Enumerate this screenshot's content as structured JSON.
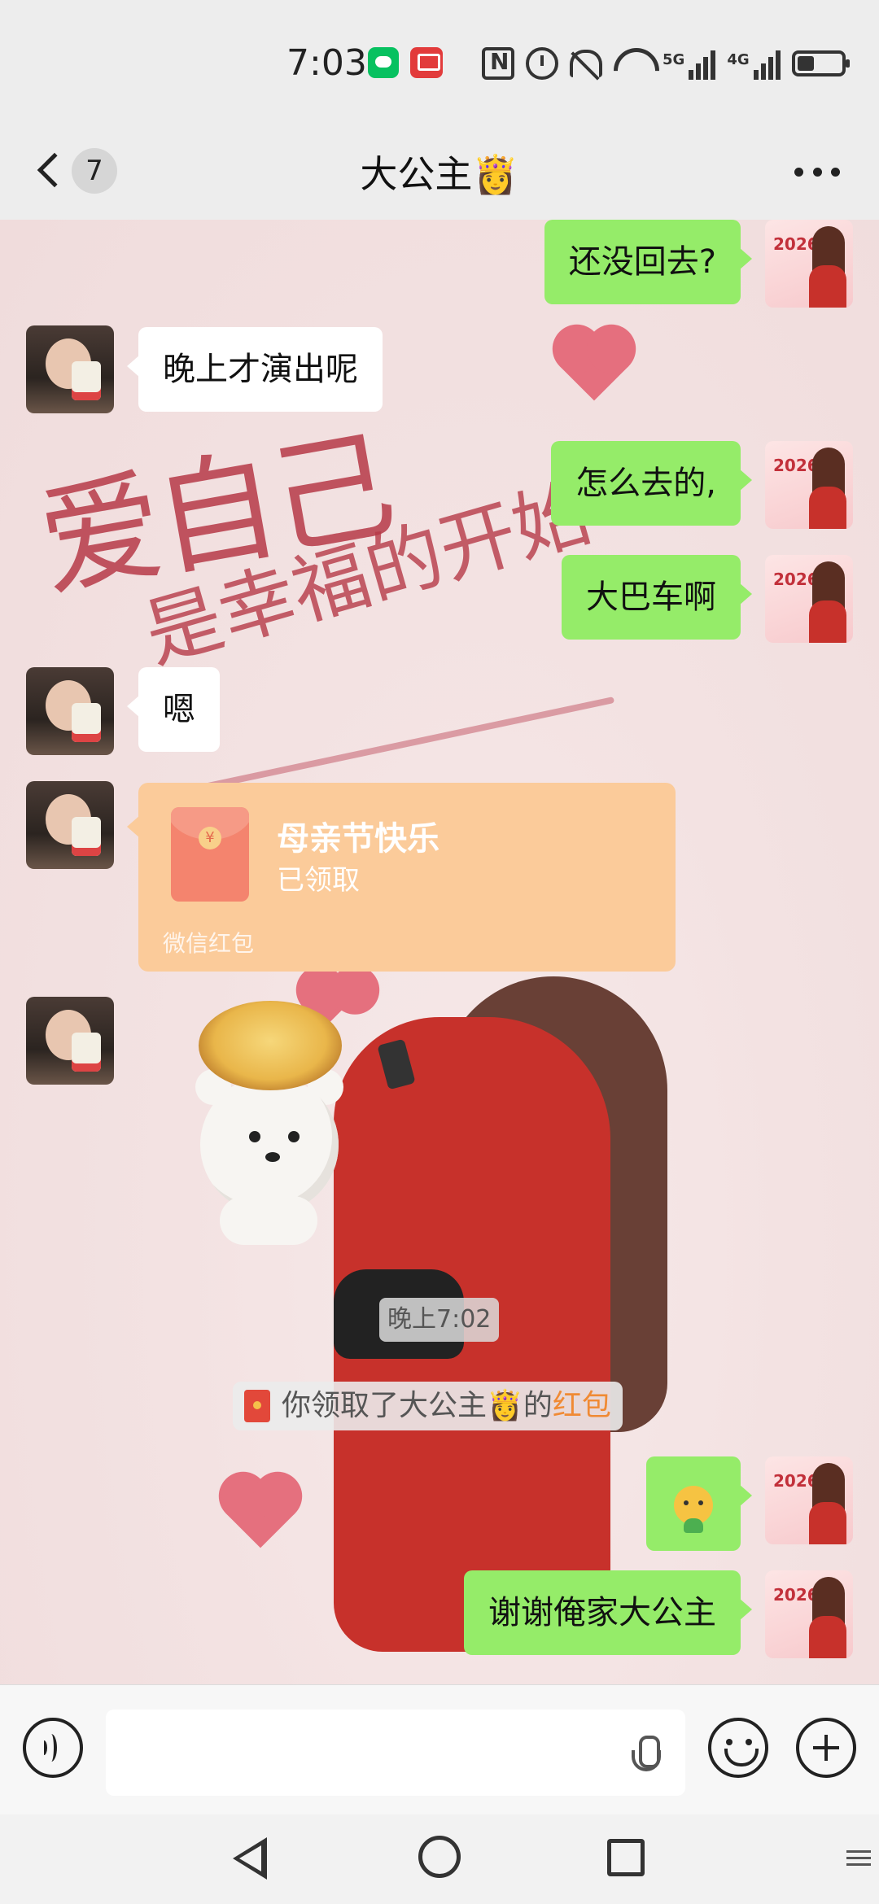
{
  "status_bar": {
    "time": "7:03",
    "network_1": "5G",
    "network_2": "4G",
    "icons": [
      "wechat-notification-icon",
      "app-notification-icon",
      "nfc-icon",
      "alarm-icon",
      "mute-icon",
      "wifi-icon",
      "signal-icon",
      "battery-icon"
    ],
    "battery_level": 0.4
  },
  "header": {
    "back_badge": "7",
    "title": "大公主👸"
  },
  "background": {
    "line1": "爱自己",
    "line2": "是幸福的开始"
  },
  "messages": [
    {
      "side": "out",
      "text": "还没回去?"
    },
    {
      "side": "in",
      "text": "晚上才演出呢"
    },
    {
      "side": "out",
      "text": "怎么去的,"
    },
    {
      "side": "out",
      "text": "大巴车啊"
    },
    {
      "side": "in",
      "text": "嗯"
    }
  ],
  "red_packet": {
    "title": "母亲节快乐",
    "status": "已领取",
    "label": "微信红包",
    "coin_symbol": "¥"
  },
  "time_stamp": "晚上7:02",
  "system_message": {
    "prefix": "你领取了大公主👸的",
    "link": "红包"
  },
  "final_messages": [
    {
      "side": "out",
      "text": "谢谢俺家大公主"
    }
  ],
  "avatar_right_text": "2026",
  "input_bar": {
    "placeholder": ""
  },
  "colors": {
    "out_bubble": "#95ec69",
    "in_bubble": "#ffffff",
    "red_packet": "#fbcb9a",
    "link": "#f08a34"
  }
}
